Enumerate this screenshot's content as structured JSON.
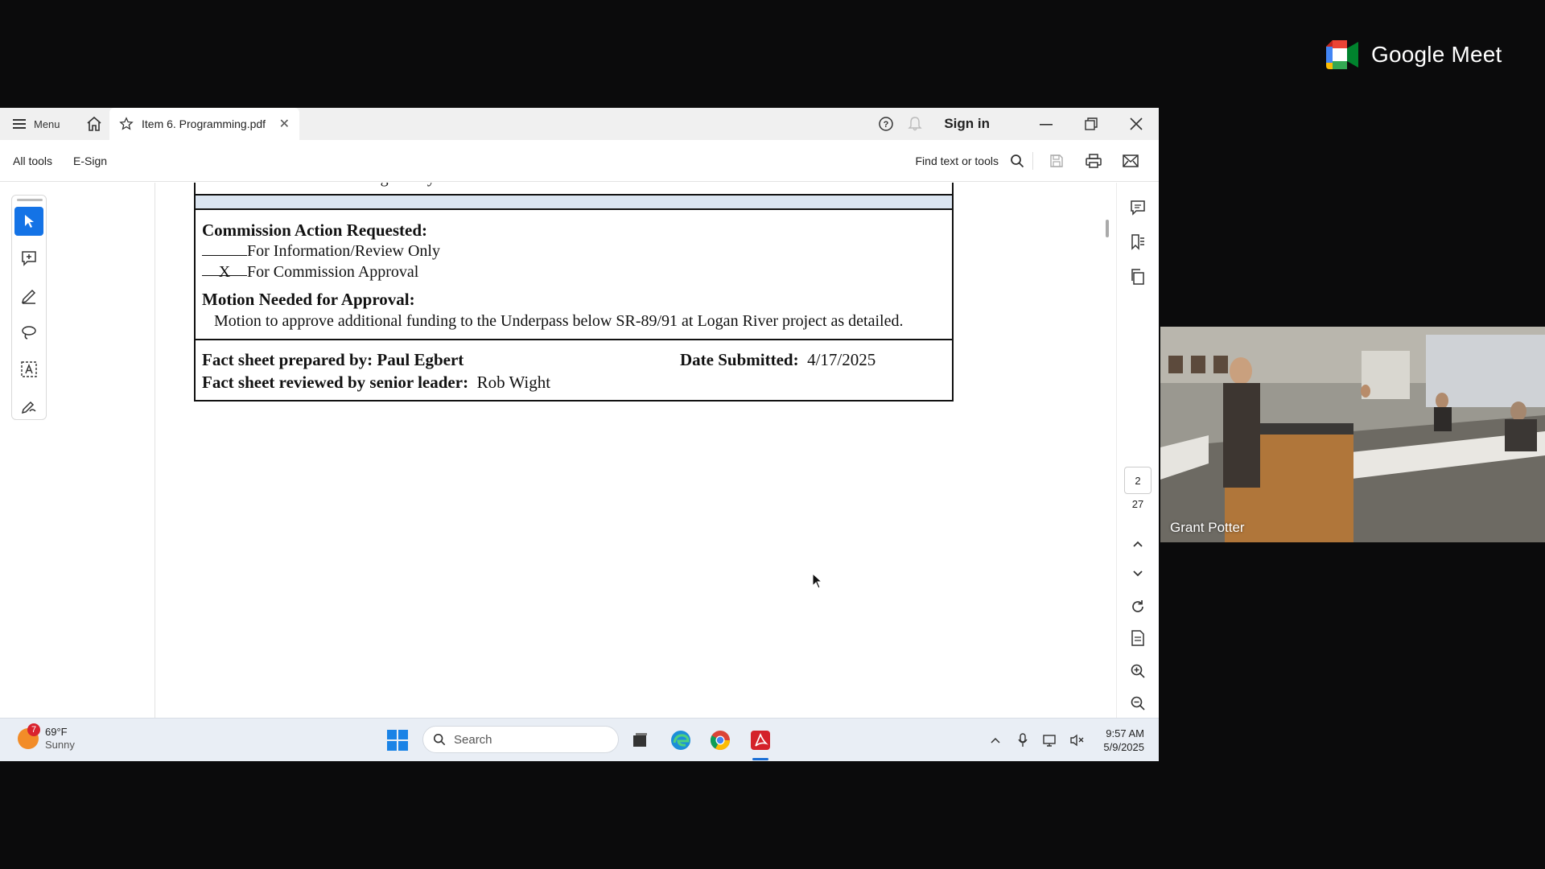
{
  "meet": {
    "brand": "Google Meet"
  },
  "acrobat": {
    "menu_label": "Menu",
    "tab_title": "Item 6. Programming.pdf",
    "sign_in": "Sign in",
    "toolbar": {
      "all_tools": "All tools",
      "esign": "E-Sign",
      "find": "Find text or tools"
    },
    "page": {
      "current": "2",
      "total": "27"
    }
  },
  "document": {
    "cut_line": "Attached is a letter from Logan City.",
    "action_heading": "Commission Action Requested:",
    "option_info": "For Information/Review Only",
    "option_info_mark": "",
    "option_approval": "For Commission Approval",
    "option_approval_mark": "X",
    "motion_heading": "Motion Needed for Approval:",
    "motion_text": "Motion to approve additional funding to the Underpass below SR-89/91 at Logan River project as detailed.",
    "prepared_label": "Fact sheet prepared by: Paul Egbert",
    "reviewed_label": "Fact sheet reviewed by senior leader:",
    "reviewed_name": "Rob Wight",
    "date_label": "Date Submitted:",
    "date_value": "4/17/2025"
  },
  "taskbar": {
    "weather_temp": "69°F",
    "weather_cond": "Sunny",
    "weather_badge": "7",
    "search_placeholder": "Search",
    "time": "9:57 AM",
    "date": "5/9/2025"
  },
  "participant": {
    "name": "Grant Potter"
  },
  "colors": {
    "accent": "#1473e6",
    "table_band": "#dbe5f1",
    "taskbar": "#e9eef5"
  }
}
